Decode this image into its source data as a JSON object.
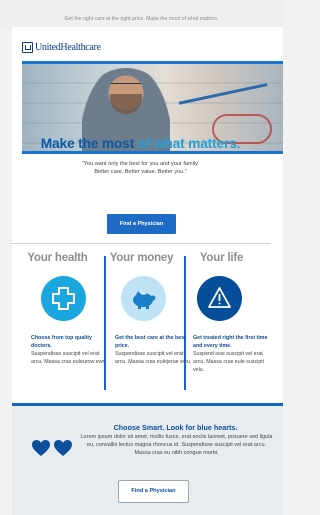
{
  "preheader": "Get the right care at the right price. Make the most of what matters.",
  "brand": {
    "logo_text": "UnitedHealthcare"
  },
  "hero": {
    "image": "smiling-man-with-bicycle"
  },
  "headline": {
    "part1": "Make the most ",
    "part2": "of what matters."
  },
  "subhead": {
    "line1": "“You want only the best for you and your family.",
    "line2": "Better care. Better value. Better you.”"
  },
  "cta_primary": "Find a Physician",
  "columns": [
    {
      "title": "Your health",
      "icon": "medical-cross-icon",
      "lead": "Choose from top quality doctors.",
      "body": "Suspendisse suscipit vel erat arcu. Massa cras euleurow ewr."
    },
    {
      "title": "Your money",
      "icon": "piggy-bank-icon",
      "lead": "Get the best care at the best price.",
      "body": "Suspendisse suscipit vel erat arcu. Massa cras eulejerue weu."
    },
    {
      "title": "Your life",
      "icon": "warning-triangle-icon",
      "lead": "Get treated right the first time and every time.",
      "body": "Suspend isse suscipit vel erat arcu. Massa cras eule suscipit velu."
    }
  ],
  "footer": {
    "title": "Choose Smart. Look for blue hearts.",
    "body": "Lorem ipsum dolor sit amet, mollis fusce, erat sociis laoreet, posuere sed ligula eu, convallis lectus magna rhoncus id. Suspendisse suscipit vel erat arcu. Massa cras eu nibh congue morbi,",
    "cta": "Find a Physician",
    "icon": "blue-hearts-icon"
  },
  "colors": {
    "brand_blue": "#0a58a8",
    "accent_cyan": "#1fa2dc",
    "button_blue": "#1d6bc4",
    "rule_blue": "#1466c5"
  }
}
